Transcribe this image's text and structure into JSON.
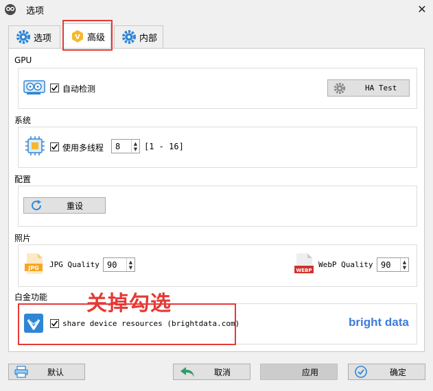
{
  "window": {
    "title": "选项"
  },
  "tabs": [
    {
      "label": "选项"
    },
    {
      "label": "高级"
    },
    {
      "label": "内部"
    }
  ],
  "gpu": {
    "label": "GPU",
    "auto_detect_label": "自动检测",
    "auto_detect_checked": true,
    "ha_test_label": "HA Test"
  },
  "system": {
    "label": "系统",
    "multithread_label": "使用多线程",
    "multithread_checked": true,
    "threads_value": "8",
    "threads_range": "[1 - 16]"
  },
  "config": {
    "label": "配置",
    "reset_label": "重设"
  },
  "photo": {
    "label": "照片",
    "jpg_icon_text": "JPG",
    "jpg_label": "JPG Quality",
    "jpg_value": "90",
    "webp_icon_text": "WEBP",
    "webp_label": "WebP Quality",
    "webp_value": "90"
  },
  "platinum": {
    "label": "白金功能",
    "share_label": "share device resources (brightdata.com)",
    "share_checked": true,
    "brand": "bright data"
  },
  "annotation": {
    "text": "关掉勾选"
  },
  "footer": {
    "default_label": "默认",
    "cancel_label": "取消",
    "apply_label": "应用",
    "ok_label": "确定"
  },
  "colors": {
    "accent_red": "#e53935",
    "gear_blue": "#2f86d6",
    "vip_gold": "#f5b82e",
    "brightdata_blue": "#3d7bd9",
    "jpg_orange": "#f5a623",
    "webp_red": "#d0312d"
  }
}
